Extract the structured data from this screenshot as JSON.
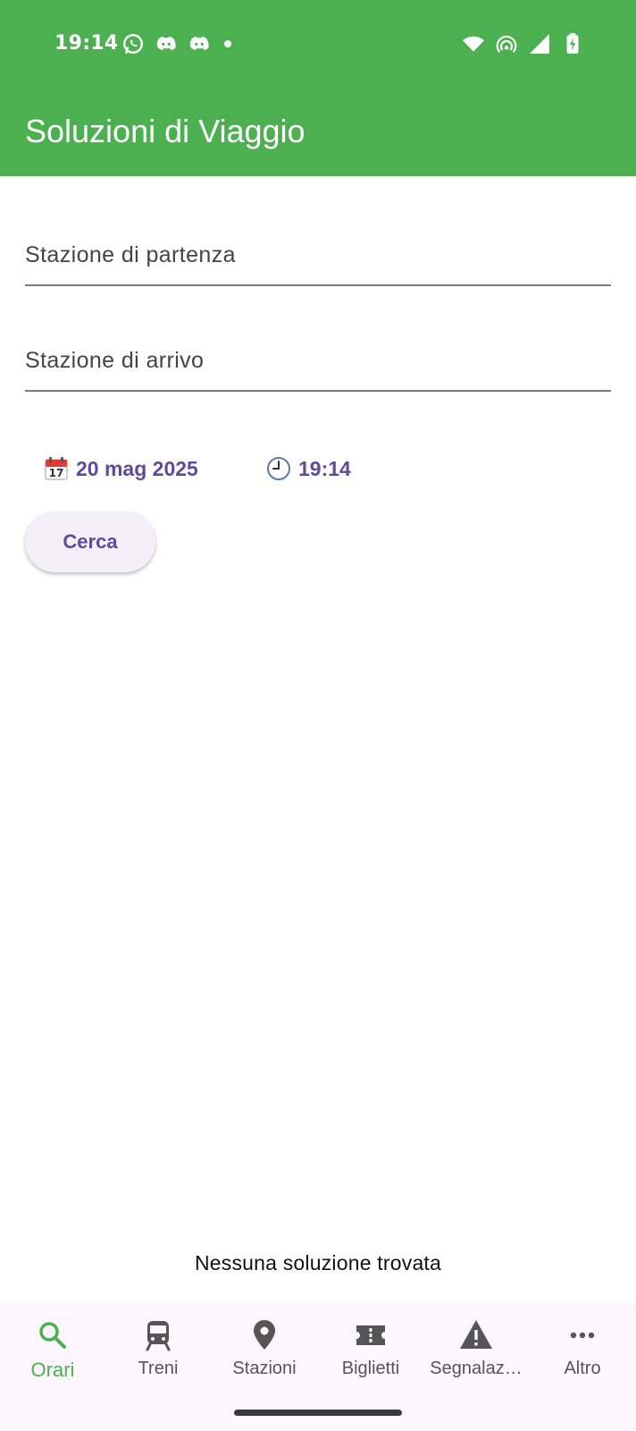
{
  "status_bar": {
    "time": "19:14",
    "left_icons": [
      "whatsapp-icon",
      "discord-icon",
      "discord-icon",
      "notification-dot"
    ],
    "right_icons": [
      "wifi-icon",
      "hotspot-icon",
      "signal-icon",
      "battery-charging-icon"
    ]
  },
  "app_bar": {
    "title": "Soluzioni di Viaggio",
    "color": "#4caf50"
  },
  "form": {
    "departure_placeholder": "Stazione di partenza",
    "arrival_placeholder": "Stazione di arrivo",
    "date_icon": "calendar-icon",
    "date_value": "20 mag 2025",
    "time_icon": "clock-icon",
    "time_value": "19:14",
    "search_label": "Cerca",
    "accent_color": "#5f4b9b"
  },
  "results": {
    "empty_message": "Nessuna soluzione trovata"
  },
  "bottom_nav": {
    "items": [
      {
        "label": "Orari",
        "icon": "search-icon",
        "active": true
      },
      {
        "label": "Treni",
        "icon": "train-icon",
        "active": false
      },
      {
        "label": "Stazioni",
        "icon": "location-pin-icon",
        "active": false
      },
      {
        "label": "Biglietti",
        "icon": "ticket-icon",
        "active": false
      },
      {
        "label": "Segnalaz…",
        "icon": "warning-icon",
        "active": false
      },
      {
        "label": "Altro",
        "icon": "more-horizontal-icon",
        "active": false
      }
    ],
    "active_color": "#4caf50",
    "inactive_color": "#555555"
  }
}
